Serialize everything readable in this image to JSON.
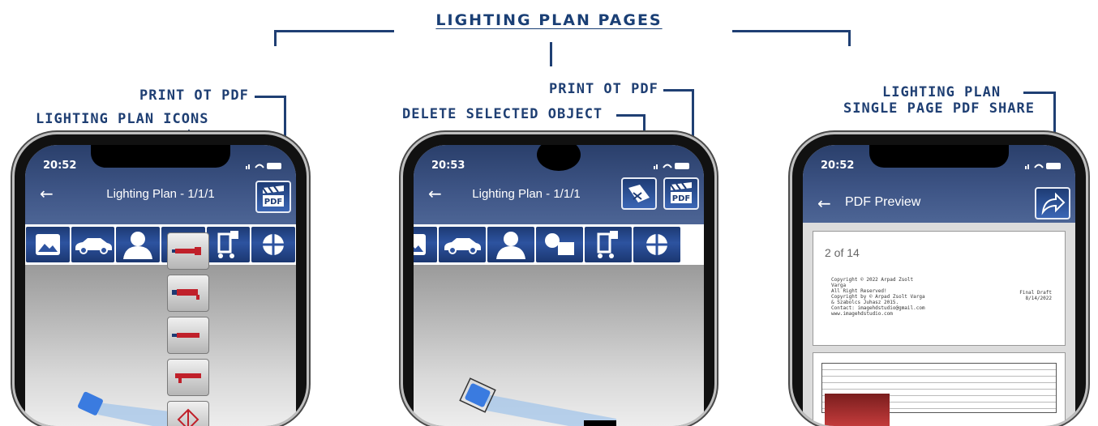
{
  "header": {
    "title": "LIGHTING PLAN PAGES"
  },
  "annotations": {
    "print_pdf_1": "PRINT OT PDF",
    "lighting_icons": "LIGHTING PLAN ICONS",
    "print_pdf_2": "PRINT OT PDF",
    "delete_object": "DELETE SELECTED OBJECT",
    "share_line1": "LIGHTING PLAN",
    "share_line2": "SINGLE PAGE PDF SHARE"
  },
  "phone1": {
    "time": "20:52",
    "nav_title": "Lighting Plan - 1/1/1",
    "pdf_label": "PDF"
  },
  "phone2": {
    "time": "20:53",
    "nav_title": "Lighting Plan - 1/1/1",
    "pdf_label": "PDF"
  },
  "phone3": {
    "time": "20:52",
    "nav_title": "PDF Preview",
    "page_counter": "2 of 14",
    "copyright_text": "Copyright © 2022 Arpad Zsolt\nVarga\nAll Right Reserved!\nCopyright by © Arpad Zsolt Varga\n& Szabolcs Juhasz 2015.\nContact: imagehdstudio@gmail.com\nwww.imagehdstudio.com",
    "draft_text": "Final Draft\n8/14/2022"
  },
  "colors": {
    "accent": "#1f3f73",
    "navbar": "#3f5687",
    "tool": "#2d53a0"
  }
}
